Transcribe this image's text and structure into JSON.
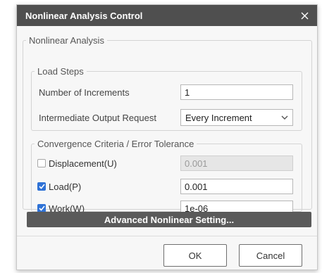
{
  "dialog": {
    "title": "Nonlinear Analysis Control",
    "close_icon": "close-icon"
  },
  "nonlinear_group": {
    "legend": "Nonlinear Analysis"
  },
  "load_steps": {
    "legend": "Load Steps",
    "increments_label": "Number of Increments",
    "increments_value": "1",
    "output_label": "Intermediate Output Request",
    "output_value": "Every Increment"
  },
  "convergence": {
    "legend": "Convergence Criteria / Error Tolerance",
    "displacement": {
      "label": "Displacement(U)",
      "checked": false,
      "value": "0.001",
      "enabled": false
    },
    "load": {
      "label": "Load(P)",
      "checked": true,
      "value": "0.001",
      "enabled": true
    },
    "work": {
      "label": "Work(W)",
      "checked": true,
      "value": "1e-06",
      "enabled": true
    }
  },
  "advanced_button": "Advanced Nonlinear Setting...",
  "buttons": {
    "ok": "OK",
    "cancel": "Cancel"
  },
  "colors": {
    "titlebar": "#4f4f4f",
    "accent": "#2f72d6",
    "advanced_button": "#5a5a5a"
  }
}
